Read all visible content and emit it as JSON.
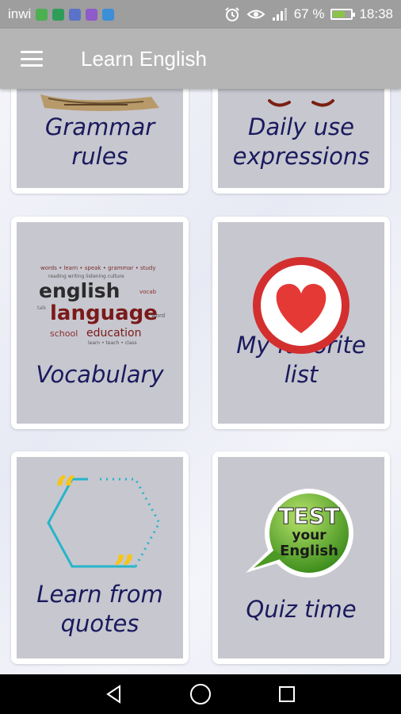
{
  "status_bar": {
    "carrier": "inwi",
    "battery_percent": "67 %",
    "time": "18:38",
    "battery_level": 0.67
  },
  "app_bar": {
    "title": "Learn English",
    "menu_icon": "hamburger-menu-icon"
  },
  "cards": [
    {
      "id": "grammar-rules",
      "label": "Grammar rules",
      "icon": "book-icon"
    },
    {
      "id": "daily-use-expressions",
      "label": "Daily use expressions",
      "icon": "mustache-icon"
    },
    {
      "id": "vocabulary",
      "label": "Vocabulary",
      "icon": "word-cloud-icon",
      "art_words": {
        "line1": "english",
        "line2": "language",
        "line3a": "school",
        "line3b": "education"
      }
    },
    {
      "id": "my-favorite-list",
      "label": "My favorite list",
      "icon": "heart-icon"
    },
    {
      "id": "learn-from-quotes",
      "label": "Learn from quotes",
      "icon": "quotes-icon"
    },
    {
      "id": "quiz-time",
      "label": "Quiz time",
      "icon": "test-badge-icon",
      "badge_text": {
        "line1": "TEST",
        "line2": "your",
        "line3": "English"
      }
    }
  ],
  "nav_bar": {
    "back_icon": "back-triangle-icon",
    "home_icon": "home-circle-icon",
    "recents_icon": "recents-square-icon"
  },
  "colors": {
    "status_bar": "#9e9e9e",
    "app_bar": "#b5b5b5",
    "card_inner": "#c7c7cf",
    "label_text": "#1a1a5e",
    "heart_red": "#e53935"
  }
}
